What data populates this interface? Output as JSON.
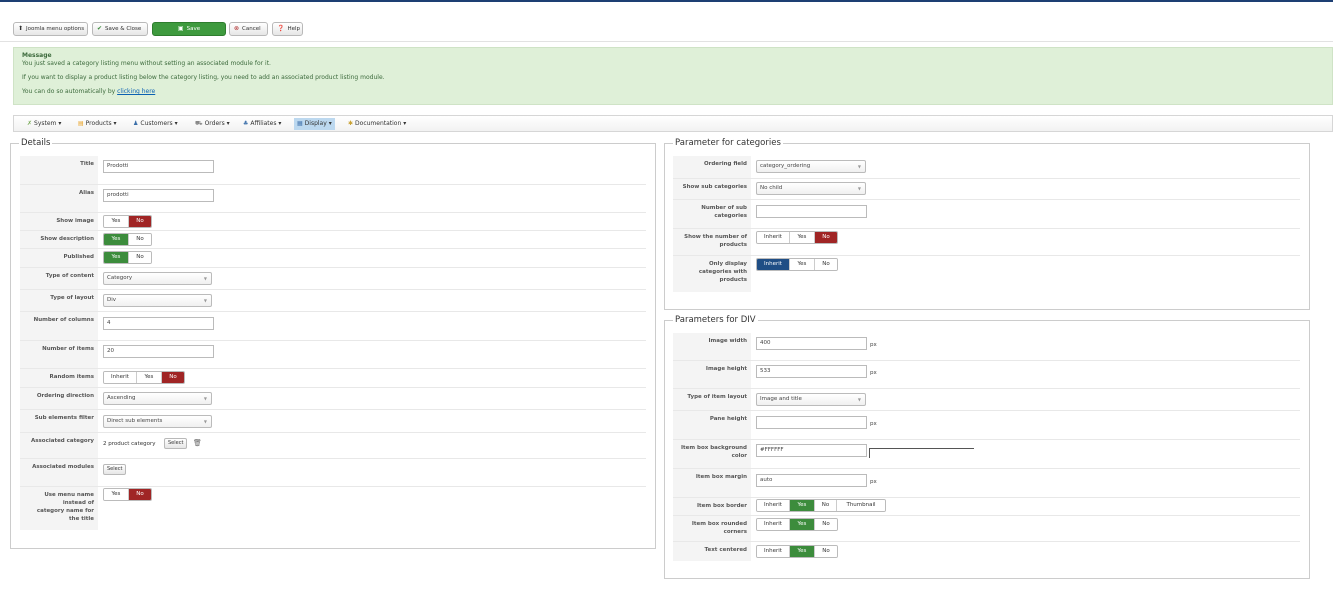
{
  "toolbar": {
    "menu_options": "Joomla menu options",
    "save_close": "Save & Close",
    "save": "Save",
    "cancel": "Cancel",
    "help": "Help"
  },
  "message": {
    "heading": "Message",
    "line1": "You just saved a category listing menu without setting an associated module for it.",
    "line2": "If you want to display a product listing below the category listing, you need to add an associated product listing module.",
    "line3_prefix": "You can do so automatically by",
    "link": "clicking here"
  },
  "nav": {
    "items": [
      {
        "label": "System",
        "icon": "wrench-icon"
      },
      {
        "label": "Products",
        "icon": "box-icon"
      },
      {
        "label": "Customers",
        "icon": "users-icon"
      },
      {
        "label": "Orders",
        "icon": "cart-icon"
      },
      {
        "label": "Affiliates",
        "icon": "affiliates-icon"
      },
      {
        "label": "Display",
        "icon": "display-icon"
      },
      {
        "label": "Documentation",
        "icon": "doc-icon"
      }
    ],
    "active": "Display"
  },
  "details": {
    "legend": "Details",
    "title_label": "Title",
    "title_value": "Prodotti",
    "alias_label": "Alias",
    "alias_value": "prodotti",
    "show_image_label": "Show image",
    "show_description_label": "Show description",
    "published_label": "Published",
    "type_content_label": "Type of content",
    "type_content_value": "Category",
    "type_layout_label": "Type of layout",
    "type_layout_value": "Div",
    "num_columns_label": "Number of columns",
    "num_columns_value": "4",
    "num_items_label": "Number of items",
    "num_items_value": "20",
    "random_items_label": "Random items",
    "ordering_direction_label": "Ordering direction",
    "ordering_direction_value": "Ascending",
    "sub_elements_label": "Sub elements filter",
    "sub_elements_value": "Direct sub elements",
    "assoc_category_label": "Associated category",
    "assoc_category_value": "2 product category",
    "assoc_modules_label": "Associated modules",
    "use_menu_name_label": "Use menu name instead of category name for the title"
  },
  "cat_params": {
    "legend": "Parameter for categories",
    "ordering_field_label": "Ordering field",
    "ordering_field_value": "category_ordering",
    "show_sub_label": "Show sub categories",
    "show_sub_value": "No child",
    "num_sub_label": "Number of sub categories",
    "show_num_products_label": "Show the number of products",
    "only_display_label": "Only display categories with products"
  },
  "div_params": {
    "legend": "Parameters for DIV",
    "image_width_label": "Image width",
    "image_width_value": "400",
    "image_height_label": "Image height",
    "image_height_value": "533",
    "item_layout_label": "Type of item layout",
    "item_layout_value": "Image and title",
    "pane_height_label": "Pane height",
    "bg_color_label": "Item box background color",
    "bg_color_value": "#FFFFFF",
    "margin_label": "Item box margin",
    "margin_value": "auto",
    "border_label": "Item box border",
    "rounded_label": "Item box rounded corners",
    "centered_label": "Text centered",
    "thumbnail": "Thumbnail"
  },
  "common": {
    "yes": "Yes",
    "no": "No",
    "inherit": "Inherit",
    "select": "Select",
    "px": "px"
  },
  "colors": {
    "on_red": "#a02525",
    "on_green": "#3c8c3c",
    "on_blue": "#1f4e85",
    "message_bg": "#dff0d8"
  }
}
